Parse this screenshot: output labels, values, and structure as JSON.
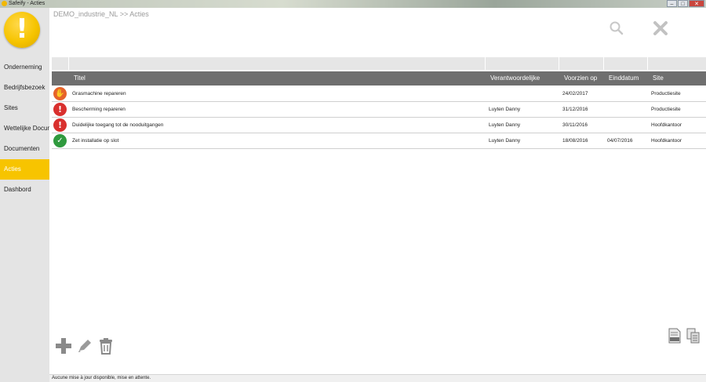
{
  "window": {
    "title": "Safeify - Acties",
    "minimize": "–",
    "maximize": "□",
    "close": "✕"
  },
  "sidebar": {
    "logo_icon": "exclamation-logo",
    "items": [
      {
        "label": "Onderneming",
        "active": false
      },
      {
        "label": "Bedrijfsbezoek",
        "active": false
      },
      {
        "label": "Sites",
        "active": false
      },
      {
        "label": "Wettelijke Documenten",
        "active": false
      },
      {
        "label": "Documenten",
        "active": false
      },
      {
        "label": "Acties",
        "active": true
      },
      {
        "label": "Dashbord",
        "active": false
      }
    ]
  },
  "main": {
    "breadcrumb": "DEMO_industrie_NL >> Acties",
    "top_icons": [
      "search-icon",
      "close-icon"
    ],
    "columns": {
      "title": "Titel",
      "responsible": "Verantwoordelijke",
      "due": "Voorzien op",
      "end": "Einddatum",
      "site": "Site"
    },
    "rows": [
      {
        "status": "hand-stop",
        "title": "Grasmachine repareren",
        "responsible": "",
        "due": "24/02/2017",
        "end": "",
        "site": "Productiesite"
      },
      {
        "status": "warning",
        "title": "Bescherming repareren",
        "responsible": "Luyten Danny",
        "due": "31/12/2016",
        "end": "",
        "site": "Productiesite"
      },
      {
        "status": "warning",
        "title": "Duidelijke toegang tot de nooduitgangen",
        "responsible": "Luyten Danny",
        "due": "30/11/2016",
        "end": "",
        "site": "Hoofdkantoor"
      },
      {
        "status": "done",
        "title": "Zet installatie op slot",
        "responsible": "Luyten Danny",
        "due": "18/08/2016",
        "end": "04/07/2016",
        "site": "Hoofdkantoor"
      }
    ],
    "bottom_tools": [
      "add-icon",
      "edit-icon",
      "delete-icon"
    ],
    "export_tools": [
      "export-xls-icon",
      "copy-documents-icon"
    ]
  },
  "statusbar": {
    "text": "Aucune mise à jour disponible, mise en attente."
  },
  "colors": {
    "accent": "#f7c400",
    "header": "#6f6f6f",
    "warn": "#d9302e",
    "hand": "#e6622a",
    "done": "#2f9a3e"
  }
}
